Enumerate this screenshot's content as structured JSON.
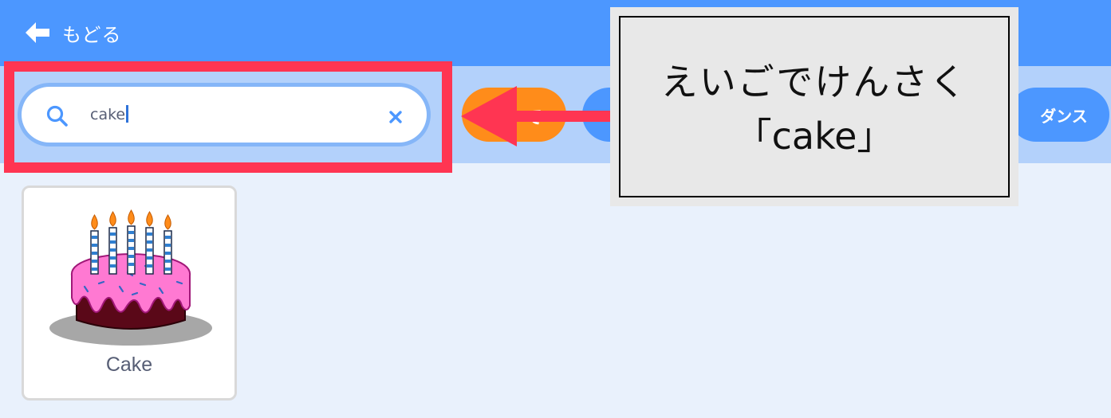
{
  "header": {
    "back_label": "もどる"
  },
  "search": {
    "value": "cake"
  },
  "filters": {
    "orange_tag_partial": "で",
    "dance_label": "ダンス"
  },
  "annotation": {
    "line1": "えいごでけんさく",
    "line2": "「cake」"
  },
  "results": [
    {
      "label": "Cake"
    }
  ],
  "colors": {
    "header_bg": "#4c97ff",
    "filter_bar_bg": "#b3d1fb",
    "page_bg": "#e9f1fc",
    "highlight": "#ff3552",
    "orange_tag": "#ff8c1a"
  },
  "icons": {
    "back": "arrow-left-icon",
    "search": "search-icon",
    "clear": "close-icon"
  }
}
